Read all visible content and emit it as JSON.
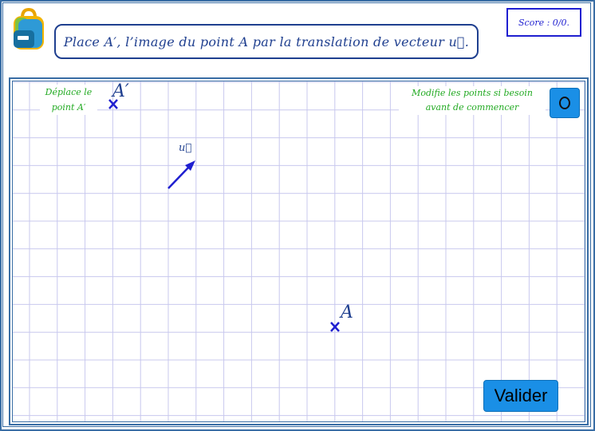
{
  "header": {
    "instruction": "Place A′, l’image du point A par la translation de vecteur u⃗.",
    "score": "Score : 0/0."
  },
  "graph": {
    "hint_left_line1": "Déplace le",
    "hint_left_line2": "point A′",
    "hint_right_line1": "Modifie les points si besoin",
    "hint_right_line2": "avant de commencer",
    "point_a_label": "A",
    "point_a_prime_label": "A′",
    "vector_label": "u⃗"
  },
  "buttons": {
    "reset_icon": "circle-reset-icon",
    "validate_label": "Valider"
  },
  "colors": {
    "frame": "#3a6ea5",
    "grid": "#c8c8ee",
    "point": "#1f1fd0",
    "hint_text": "#22aa22",
    "button": "#1a8fe6"
  }
}
